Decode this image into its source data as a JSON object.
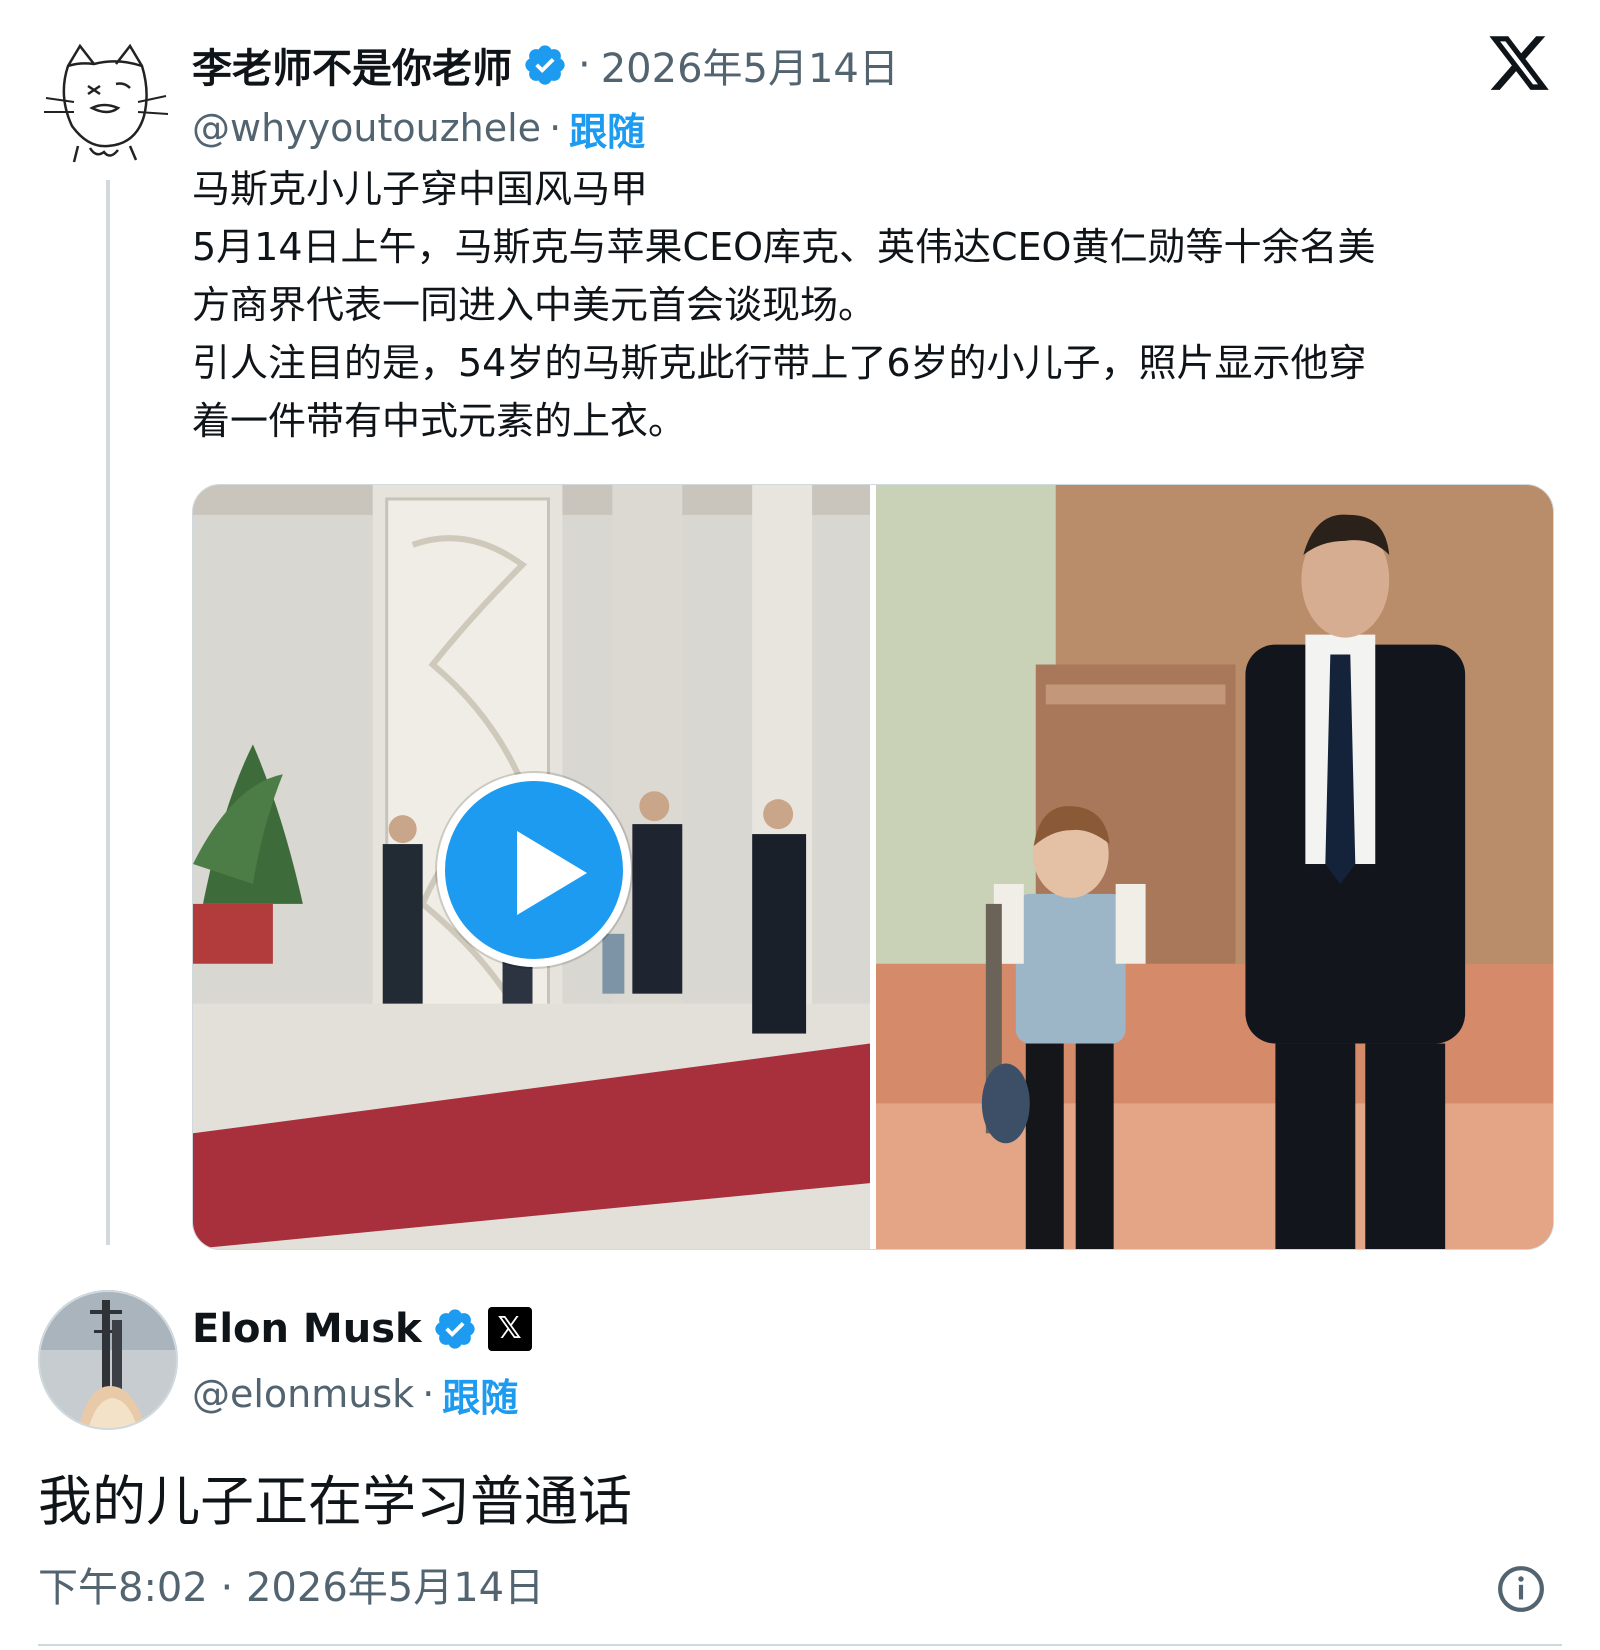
{
  "quoted_tweet": {
    "author_name": "李老师不是你老师",
    "separator": "·",
    "date": "2026年5月14日",
    "handle": "@whyyoutouzhele",
    "handle_separator": "·",
    "follow_label": "跟随",
    "text_lines": [
      "马斯克小儿子穿中国风马甲",
      "5月14日上午，马斯克与苹果CEO库克、英伟达CEO黄仁勋等十余名美",
      "方商界代表一同进入中美元首会谈现场。",
      "引人注目的是，54岁的马斯克此行带上了6岁的小儿子，照片显示他穿",
      "着一件带有中式元素的上衣。"
    ]
  },
  "main_tweet": {
    "author_name": "Elon Musk",
    "affiliate_badge": "𝕏",
    "handle": "@elonmusk",
    "handle_separator": "·",
    "follow_label": "跟随",
    "text": "我的儿子正在学习普通话",
    "timestamp": "下午8:02 · 2026年5月14日"
  },
  "icons": {
    "verified": "verified-badge-icon",
    "x_logo": "x-logo-icon",
    "play": "play-icon",
    "info": "info-icon"
  },
  "colors": {
    "accent": "#1d9bf0",
    "text": "#0f1419",
    "secondary": "#536471",
    "border": "#cfd9de"
  }
}
